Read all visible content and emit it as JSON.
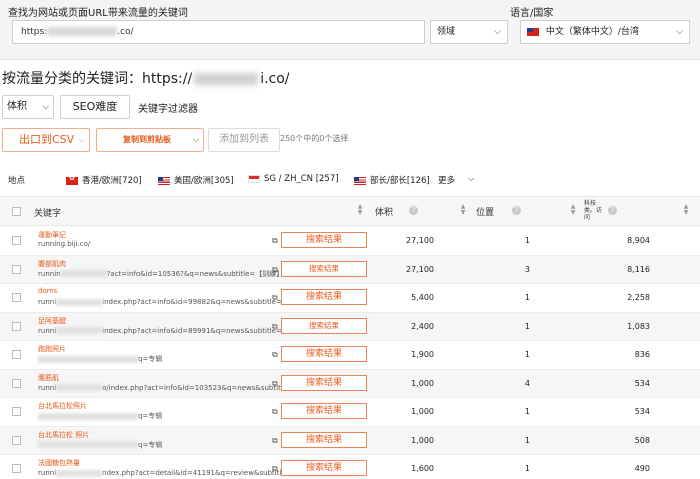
{
  "search": {
    "find_label": "查找为网站或页面URL带来流量的关键词",
    "url_value": "https:",
    "url_value_end": ".co/",
    "domain_select": "领域",
    "lang_label": "语言/国家",
    "lang_select": "中文（繁体中文）/台湾"
  },
  "heading": {
    "prefix": "按流量分类的关键词：https://",
    "suffix": "i.co/"
  },
  "toolbar": {
    "volume_label": "体积",
    "seo_label": "SEO难度",
    "filter_label": "关键字过滤器",
    "export_label": "出口到CSV",
    "copy_label": "复制到剪贴板",
    "addlist_label": "添加到列表",
    "selection_count": "250个中的0个选择"
  },
  "filters": {
    "location_label": "地点",
    "hk_label": "香港/欧洲[720]",
    "us_label": "美国/欧洲[305]",
    "sg_label": "SG / ZH_CN  [257]",
    "min_label": "部长/部长[126]",
    "more_label": "更多"
  },
  "table": {
    "col_keyword": "关键字",
    "col_volume": "体积",
    "col_position": "位置",
    "col_estimate": "科技类。访问",
    "serp_label": "搜索结果",
    "rows": [
      {
        "kw": "運動筆記",
        "url_a": "running.biji.co/",
        "url_b": "",
        "serp_small": false,
        "volume": "27,100",
        "position": "1",
        "estimate": "8,904"
      },
      {
        "kw": "腹部肌肉",
        "url_a": "runnin",
        "url_b": "?act=info&id=10536?&q=news&subtitle=【訓練】...",
        "serp_small": true,
        "volume": "27,100",
        "position": "3",
        "estimate": "8,116"
      },
      {
        "kw": "doms",
        "url_a": "runni",
        "url_b": "index.php?act=info&id=99882&q=news&subtitle=【迷思】 肌...",
        "serp_small": false,
        "volume": "5,400",
        "position": "1",
        "estimate": "2,258"
      },
      {
        "kw": "足阿基腱",
        "url_a": "runni",
        "url_b": "index.php?act=info&id=89991&q=news&subtitle=足阿基腱多...",
        "serp_small": true,
        "volume": "2,400",
        "position": "1",
        "estimate": "1,083"
      },
      {
        "kw": "跑跑照片",
        "url_a": "",
        "url_b": "q=专辑",
        "serp_small": false,
        "volume": "1,900",
        "position": "1",
        "estimate": "836"
      },
      {
        "kw": "鹰筋肌",
        "url_a": "runni",
        "url_b": "o/index.php?act=info&id=103523&q=news&subtitle=【知識】...",
        "serp_small": false,
        "volume": "1,000",
        "position": "4",
        "estimate": "534"
      },
      {
        "kw": "台北馬拉松照片",
        "url_a": "",
        "url_b": "q=专辑",
        "serp_small": false,
        "volume": "1,000",
        "position": "1",
        "estimate": "534"
      },
      {
        "kw": "台北馬拉松 照片",
        "url_a": "",
        "url_b": "q=专辑",
        "serp_small": false,
        "volume": "1,000",
        "position": "1",
        "estimate": "508"
      },
      {
        "kw": "法國糖包熱量",
        "url_a": "runni",
        "url_b": "ndex.php?act=detail&id=41191&q=review&subtitle=【最不腰...",
        "serp_small": false,
        "volume": "1,600",
        "position": "1",
        "estimate": "490"
      }
    ]
  }
}
